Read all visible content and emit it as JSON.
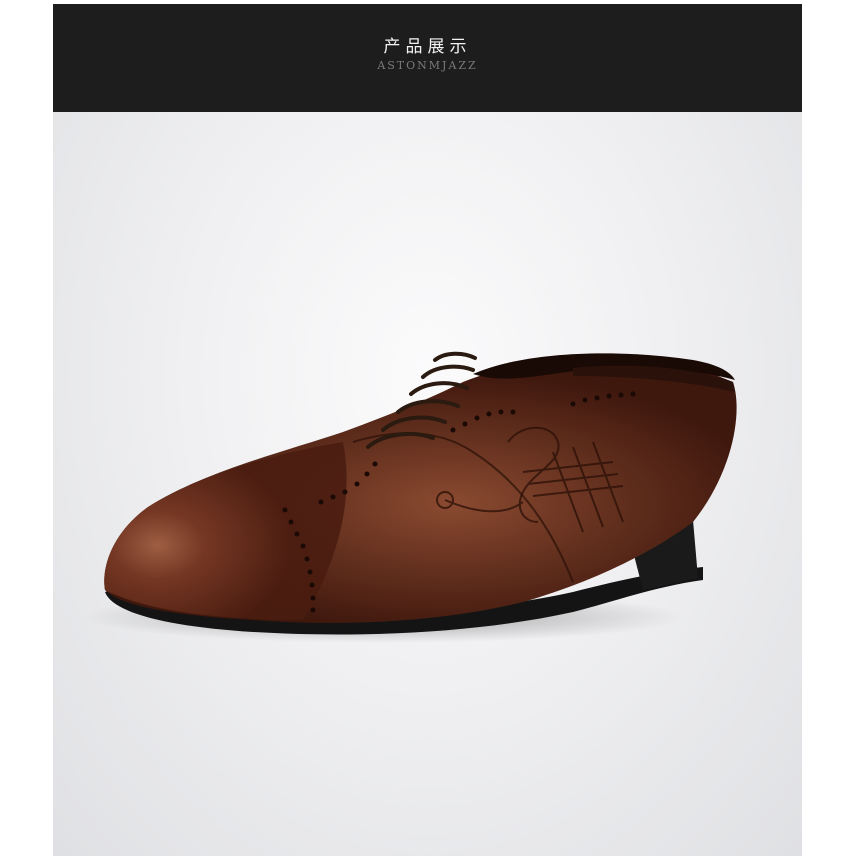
{
  "banner": {
    "title": "产品展示",
    "subtitle": "ASTONMJAZZ"
  },
  "product_image": {
    "icon": "oxford-brogue-shoe-icon",
    "colors": {
      "leather": "#5a2416",
      "leather_highlight": "#9a5a3e",
      "sole": "#151515",
      "background": "#f0f0f2"
    }
  }
}
